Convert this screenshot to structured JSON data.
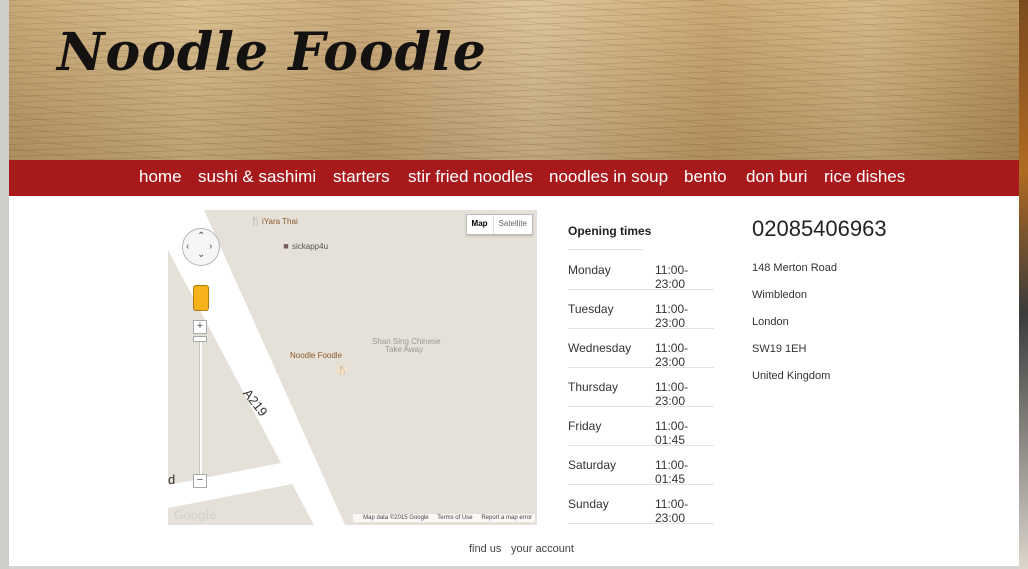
{
  "site": {
    "title": "Noodle Foodle"
  },
  "nav": {
    "items": [
      {
        "label": "home"
      },
      {
        "label": "sushi & sashimi"
      },
      {
        "label": "starters"
      },
      {
        "label": "stir fried noodles"
      },
      {
        "label": "noodles in soup"
      },
      {
        "label": "bento"
      },
      {
        "label": "don buri"
      },
      {
        "label": "rice dishes"
      }
    ]
  },
  "map": {
    "type_buttons": {
      "map": "Map",
      "satellite": "Satellite"
    },
    "pois": {
      "iyara": "iYara Thai",
      "sickapp": "sickapp4u",
      "shan_sing_1": "Shan Sing Chinese",
      "shan_sing_2": "Take Away",
      "noodle_foodle": "Noodle Foodle"
    },
    "road": "A219",
    "edge_letter": "d",
    "logo": "Google",
    "footer": {
      "data": "Map data ©2015 Google",
      "terms": "Terms of Use",
      "report": "Report a map error"
    }
  },
  "hours": {
    "title": "Opening times",
    "rows": [
      {
        "day": "Monday",
        "time": "11:00-23:00"
      },
      {
        "day": "Tuesday",
        "time": "11:00-23:00"
      },
      {
        "day": "Wednesday",
        "time": "11:00-23:00"
      },
      {
        "day": "Thursday",
        "time": "11:00-23:00"
      },
      {
        "day": "Friday",
        "time": "11:00-01:45"
      },
      {
        "day": "Saturday",
        "time": "11:00-01:45"
      },
      {
        "day": "Sunday",
        "time": "11:00-23:00"
      }
    ]
  },
  "contact": {
    "phone": "02085406963",
    "address": [
      "148 Merton Road",
      "Wimbledon",
      "London",
      "SW19 1EH",
      "United Kingdom"
    ]
  },
  "footer": {
    "find_us": "find us",
    "account": "your account"
  },
  "colors": {
    "nav_bg": "#a8191c",
    "nav_text": "#ffffff",
    "map_land": "#e6e1d8",
    "map_road": "#ffffff"
  }
}
